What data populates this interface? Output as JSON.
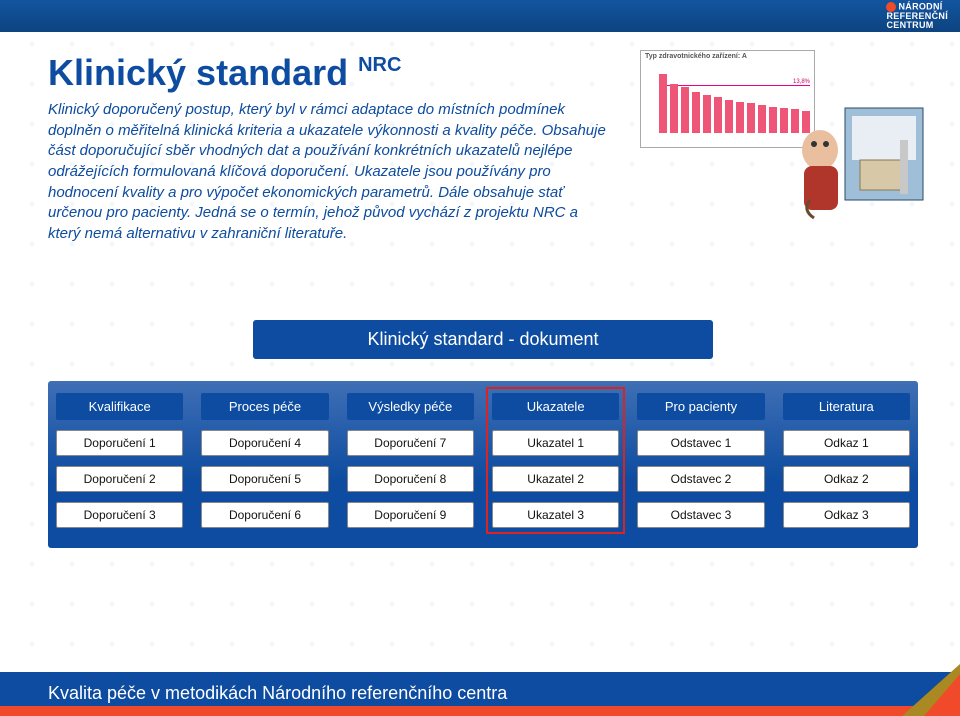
{
  "logo": {
    "line1": "NÁRODNÍ",
    "line2": "REFERENČNÍ",
    "line3": "CENTRUM"
  },
  "title": "Klinický standard",
  "title_sup": "NRC",
  "body": "Klinický doporučený postup, který byl v rámci adaptace do místních podmínek doplněn o měřitelná klinická kriteria a ukazatele výkonnosti a kvality péče. Obsahuje část doporučující sběr vhodných dat a používání konkrétních ukazatelů nejlépe odrážejících formulovaná klíčová doporučení. Ukazatele jsou používány pro hodnocení kvality a pro výpočet ekonomických parametrů. Dále obsahuje stať určenou pro pacienty. Jedná se o termín, jehož původ vychází z projektu NRC a který nemá alternativu v zahraniční literatuře.",
  "chart": {
    "title": "Typ zdravotnického zařízení: A",
    "ref_label": "13,8%"
  },
  "diagram": {
    "title": "Klinický standard - dokument",
    "columns": [
      {
        "header": "Kvalifikace",
        "rows": [
          "Doporučení 1",
          "Doporučení 2",
          "Doporučení 3"
        ],
        "highlight": false
      },
      {
        "header": "Proces péče",
        "rows": [
          "Doporučení 4",
          "Doporučení 5",
          "Doporučení 6"
        ],
        "highlight": false
      },
      {
        "header": "Výsledky péče",
        "rows": [
          "Doporučení 7",
          "Doporučení 8",
          "Doporučení 9"
        ],
        "highlight": false
      },
      {
        "header": "Ukazatele",
        "rows": [
          "Ukazatel 1",
          "Ukazatel 2",
          "Ukazatel 3"
        ],
        "highlight": true
      },
      {
        "header": "Pro pacienty",
        "rows": [
          "Odstavec 1",
          "Odstavec 2",
          "Odstavec 3"
        ],
        "highlight": false
      },
      {
        "header": "Literatura",
        "rows": [
          "Odkaz 1",
          "Odkaz 2",
          "Odkaz 3"
        ],
        "highlight": false
      }
    ]
  },
  "footer": "Kvalita péče v metodikách Národního referenčního centra"
}
